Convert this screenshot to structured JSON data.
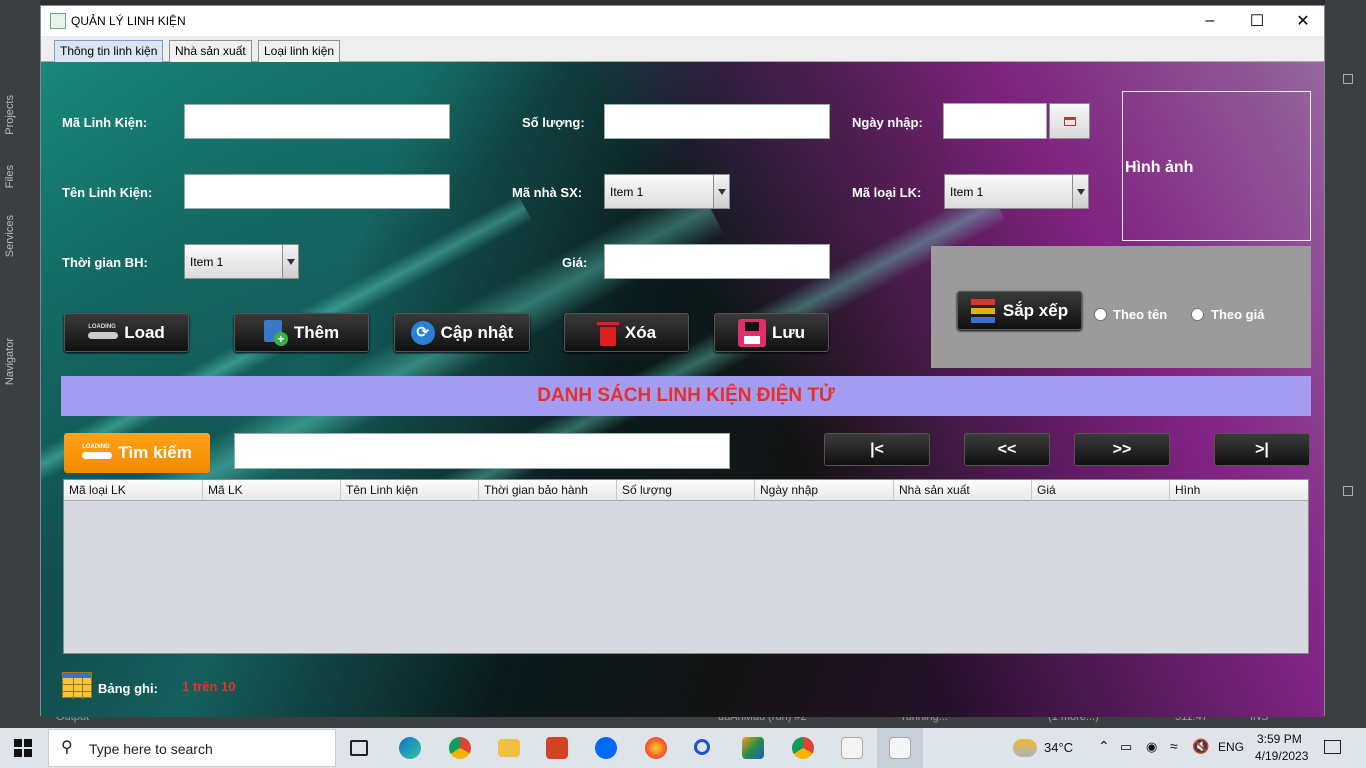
{
  "window": {
    "title": "QUẢN LÝ LINH KIỆN"
  },
  "tabs": [
    "Thông tin linh kiện",
    "Nhà sản xuất",
    "Loại linh kiện"
  ],
  "form": {
    "ma_lk_label": "Mã Linh Kiện:",
    "ten_lk_label": "Tên Linh Kiện:",
    "thoi_gian_bh_label": "Thời gian BH:",
    "so_luong_label": "Số lượng:",
    "ma_nsx_label": "Mã nhà SX:",
    "gia_label": "Giá:",
    "ngay_nhap_label": "Ngày nhập:",
    "ma_loai_label": "Mã loại LK:",
    "thoi_gian_bh_value": "Item 1",
    "ma_nsx_value": "Item 1",
    "ma_loai_value": "Item 1",
    "image_label": "Hình ảnh"
  },
  "buttons": {
    "load": "Load",
    "them": "Thêm",
    "cap_nhat": "Cập nhật",
    "xoa": "Xóa",
    "luu": "Lưu",
    "sap_xep": "Sắp xếp",
    "tim_kiem": "Tìm kiếm",
    "first": "|<",
    "prev": "<<",
    "next": ">>",
    "last": ">|",
    "loading_tag": "LOADING"
  },
  "sort": {
    "by_name": "Theo tên",
    "by_price": "Theo giá"
  },
  "banner": "DANH SÁCH LINH KIỆN ĐIỆN TỬ",
  "table": {
    "columns": [
      "Mã loại LK",
      "Mã LK",
      "Tên Linh kiện",
      "Thời gian bảo hành",
      "Số lượng",
      "Ngày nhập",
      "Nhà sản xuất",
      "Giá",
      "Hình"
    ]
  },
  "records": {
    "label": "Bảng ghi:",
    "value": "1 trên 10"
  },
  "ide": {
    "projects": "Projects",
    "files": "Files",
    "services": "Services",
    "navigator": "Navigator",
    "output": "Output",
    "status_run": "duAnMau (run) #2",
    "status_running": "running...",
    "status_more": "(1 more...)",
    "status_pos": "311:47",
    "status_ins": "INS"
  },
  "taskbar": {
    "search_placeholder": "Type here to search",
    "weather": "34°C",
    "lang": "ENG",
    "time": "3:59 PM",
    "date": "4/19/2023"
  }
}
